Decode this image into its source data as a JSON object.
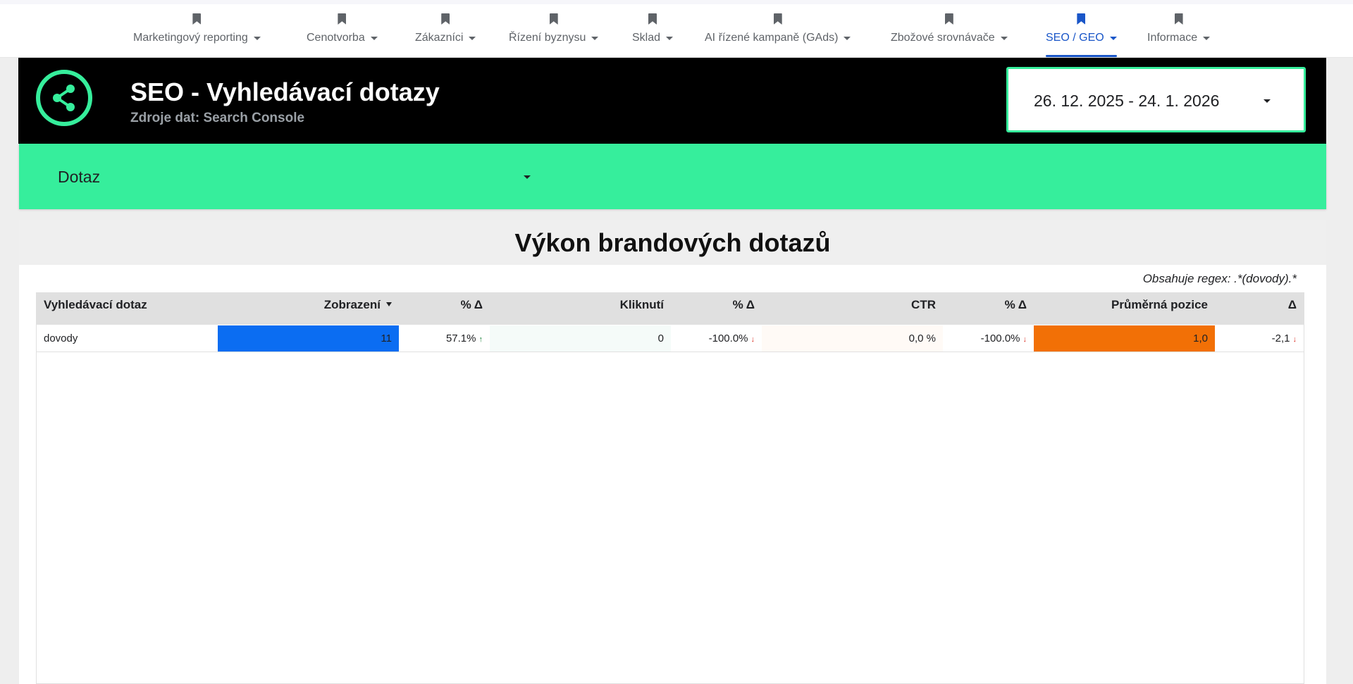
{
  "nav": {
    "items": [
      {
        "label": "Marketingový reporting",
        "active": false
      },
      {
        "label": "Cenotvorba",
        "active": false
      },
      {
        "label": "Zákazníci",
        "active": false
      },
      {
        "label": "Řízení byznysu",
        "active": false
      },
      {
        "label": "Sklad",
        "active": false
      },
      {
        "label": "AI řízené kampaně (GAds)",
        "active": false
      },
      {
        "label": "Zbožové srovnávače",
        "active": false
      },
      {
        "label": "SEO / GEO",
        "active": true
      },
      {
        "label": "Informace",
        "active": false
      }
    ],
    "icon": "bookmark-icon",
    "active_color": "#1a56c8"
  },
  "header": {
    "title": "SEO - Vyhledávací dotazy",
    "subtitle": "Zdroje dat: Search Console",
    "logo_icon": "share-icon",
    "accent_color": "#36ee9c",
    "date_range": "26. 12. 2025 - 24. 1. 2026"
  },
  "filter": {
    "label": "Dotaz"
  },
  "section": {
    "title": "Výkon brandových dotazů",
    "regex_note": "Obsahuje regex: .*(dovody).*"
  },
  "table": {
    "headers": {
      "query": "Vyhledávací dotaz",
      "impressions": "Zobrazení",
      "impressions_delta": "% Δ",
      "clicks": "Kliknutí",
      "clicks_delta": "% Δ",
      "ctr": "CTR",
      "ctr_delta": "% Δ",
      "position": "Průměrná pozice",
      "position_delta": "Δ"
    },
    "sorted_by": "impressions",
    "sort_direction": "desc",
    "rows": [
      {
        "query": "dovody",
        "impressions": "11",
        "impressions_delta": "57.1%",
        "impressions_trend": "up",
        "clicks": "0",
        "clicks_delta": "-100.0%",
        "clicks_trend": "down",
        "ctr": "0,0 %",
        "ctr_delta": "-100.0%",
        "ctr_trend": "down",
        "position": "1,0",
        "position_delta": "-2,1",
        "position_trend": "down"
      }
    ],
    "colors": {
      "impressions_bar": "#0b6df2",
      "clicks_bar": "#f5fbf9",
      "ctr_bar": "#fffaf6",
      "position_bar": "#f27006",
      "trend_up": "#188038",
      "trend_down": "#d93025"
    }
  }
}
